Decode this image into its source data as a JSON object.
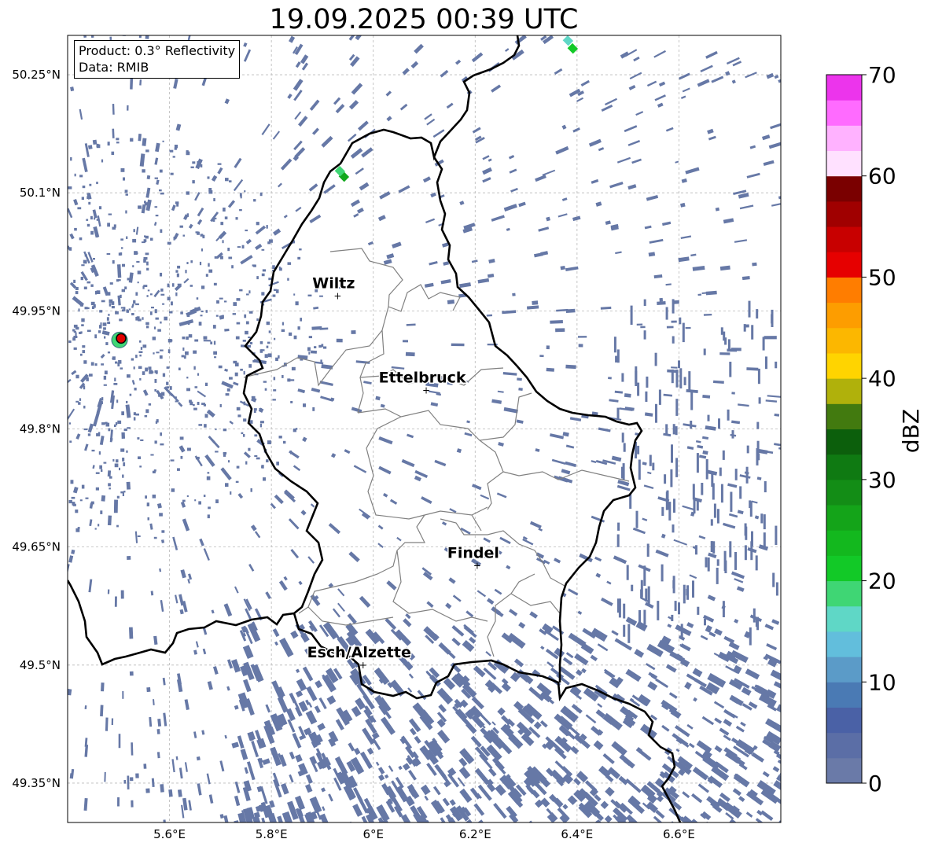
{
  "title": "19.09.2025 00:39 UTC",
  "info": {
    "product": "Product: 0.3° Reflectivity",
    "data": "Data: RMIB"
  },
  "map": {
    "lon_range": [
      5.4,
      6.8
    ],
    "lat_range": [
      49.3,
      50.3
    ],
    "x_ticks": [
      {
        "value": 5.6,
        "label": "5.6°E"
      },
      {
        "value": 5.8,
        "label": "5.8°E"
      },
      {
        "value": 6.0,
        "label": "6°E"
      },
      {
        "value": 6.2,
        "label": "6.2°E"
      },
      {
        "value": 6.4,
        "label": "6.4°E"
      },
      {
        "value": 6.6,
        "label": "6.6°E"
      }
    ],
    "y_ticks": [
      {
        "value": 49.35,
        "label": "49.35°N"
      },
      {
        "value": 49.5,
        "label": "49.5°N"
      },
      {
        "value": 49.65,
        "label": "49.65°N"
      },
      {
        "value": 49.8,
        "label": "49.8°N"
      },
      {
        "value": 49.95,
        "label": "49.95°N"
      },
      {
        "value": 50.1,
        "label": "50.1°N"
      },
      {
        "value": 50.25,
        "label": "50.25°N"
      }
    ],
    "grid": true,
    "cities": [
      {
        "name": "Wiltz",
        "lon": 5.93,
        "lat": 49.969
      },
      {
        "name": "Ettelbruck",
        "lon": 6.104,
        "lat": 49.849
      },
      {
        "name": "Findel",
        "lon": 6.204,
        "lat": 49.626
      },
      {
        "name": "Esch/Alzette",
        "lon": 5.98,
        "lat": 49.5
      }
    ],
    "radar_site": {
      "lon": 5.505,
      "lat": 49.915,
      "color": "#e00000"
    }
  },
  "colorbar": {
    "label": "dBZ",
    "min": 0,
    "max": 70,
    "ticks": [
      0,
      10,
      20,
      30,
      40,
      50,
      60,
      70
    ],
    "colors": [
      "#6a7aa8",
      "#5b6ea6",
      "#4a61a6",
      "#4a7ab4",
      "#5b9bc8",
      "#62bedc",
      "#5fd7c6",
      "#3fd674",
      "#12c927",
      "#13b81e",
      "#14a419",
      "#138d16",
      "#0f7a12",
      "#0c5f0c",
      "#427a0f",
      "#b0b10b",
      "#ffd400",
      "#fcb700",
      "#fd9d00",
      "#ff7d00",
      "#e60000",
      "#c80000",
      "#a00000",
      "#7a0000",
      "#ffe1ff",
      "#ffb2ff",
      "#ff6bff",
      "#ec34ec"
    ]
  },
  "echo_color": "#6678a6"
}
